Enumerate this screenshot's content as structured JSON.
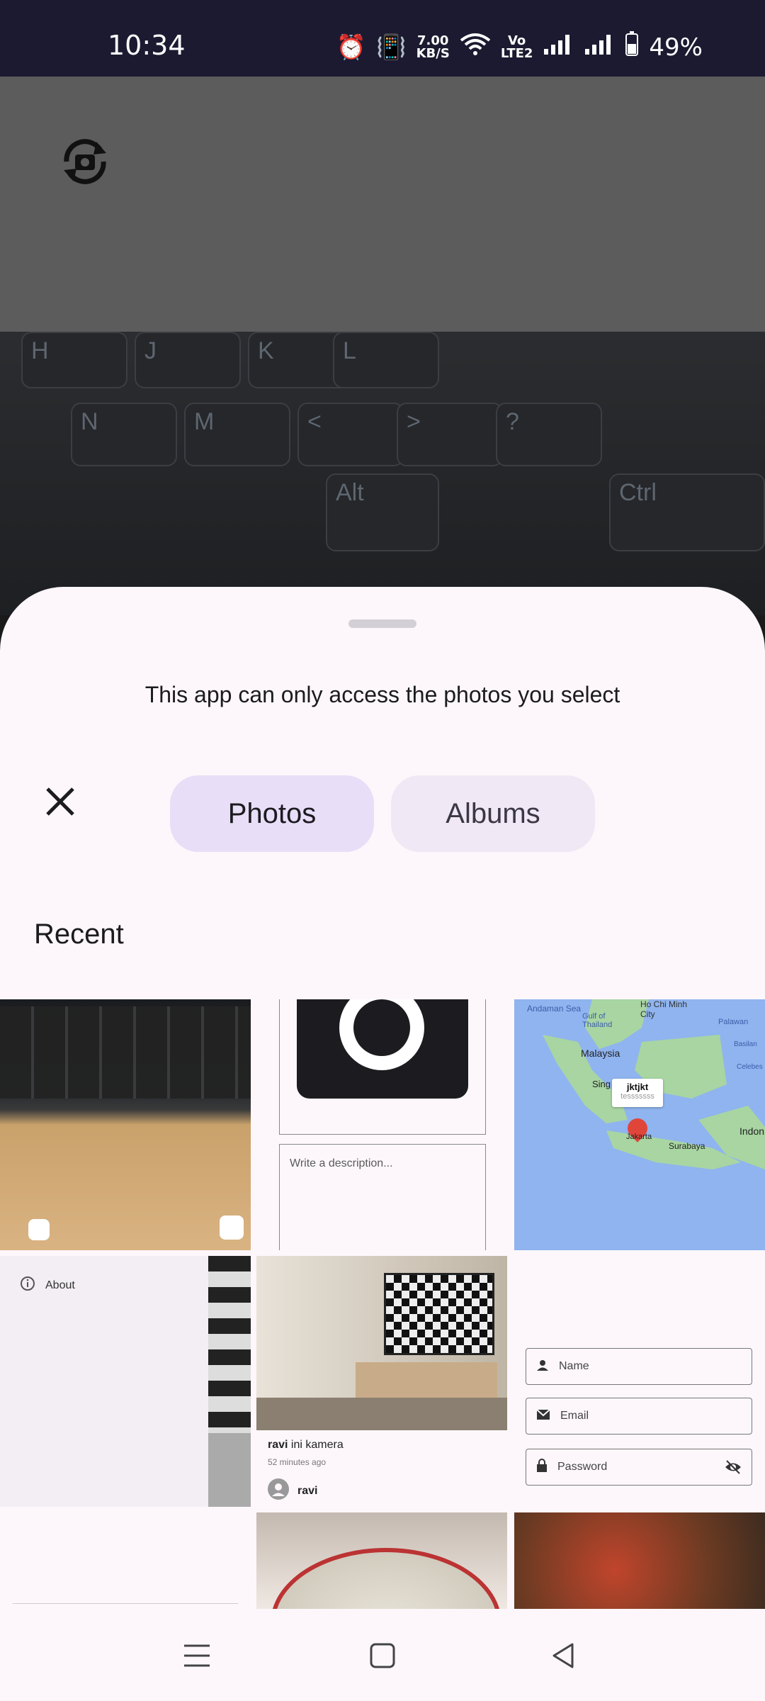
{
  "status_bar": {
    "time": "10:34",
    "net_speed_value": "7.00",
    "net_speed_unit": "KB/S",
    "volte_top": "Vo",
    "volte_bottom": "LTE2",
    "battery": "49%"
  },
  "keyboard": {
    "keys": [
      "H",
      "J",
      "K",
      "L",
      "N",
      "M",
      "<",
      ">",
      "?",
      "Alt",
      "Ctrl"
    ]
  },
  "sheet": {
    "title": "This app can only access the photos you select",
    "tabs": {
      "photos": "Photos",
      "albums": "Albums"
    },
    "section_title": "Recent"
  },
  "tiles": {
    "camera_form": {
      "description_placeholder": "Write a description..."
    },
    "map": {
      "place_labels": [
        "Andaman Sea",
        "Ho Chi Minh City",
        "Gulf of Thailand",
        "Palawan",
        "Malaysia",
        "Basilan",
        "Celebes",
        "Sing",
        "Surabaya",
        "Indon"
      ],
      "marker_title": "jktjkt",
      "marker_subtitle": "tesssssss",
      "marker_city": "Jakarta"
    },
    "about_menu": {
      "label": "About"
    },
    "post": {
      "user": "ravi",
      "caption": "ini kamera",
      "time": "52 minutes ago",
      "author": "ravi"
    },
    "signup_form": {
      "name": "Name",
      "email": "Email",
      "password": "Password"
    }
  },
  "colors": {
    "accent": "#e8def8",
    "sheet": "#fdf7fb",
    "status_bar": "#1c1a30",
    "map_sea": "#8fb4ef",
    "map_land": "#a8d5a2"
  }
}
